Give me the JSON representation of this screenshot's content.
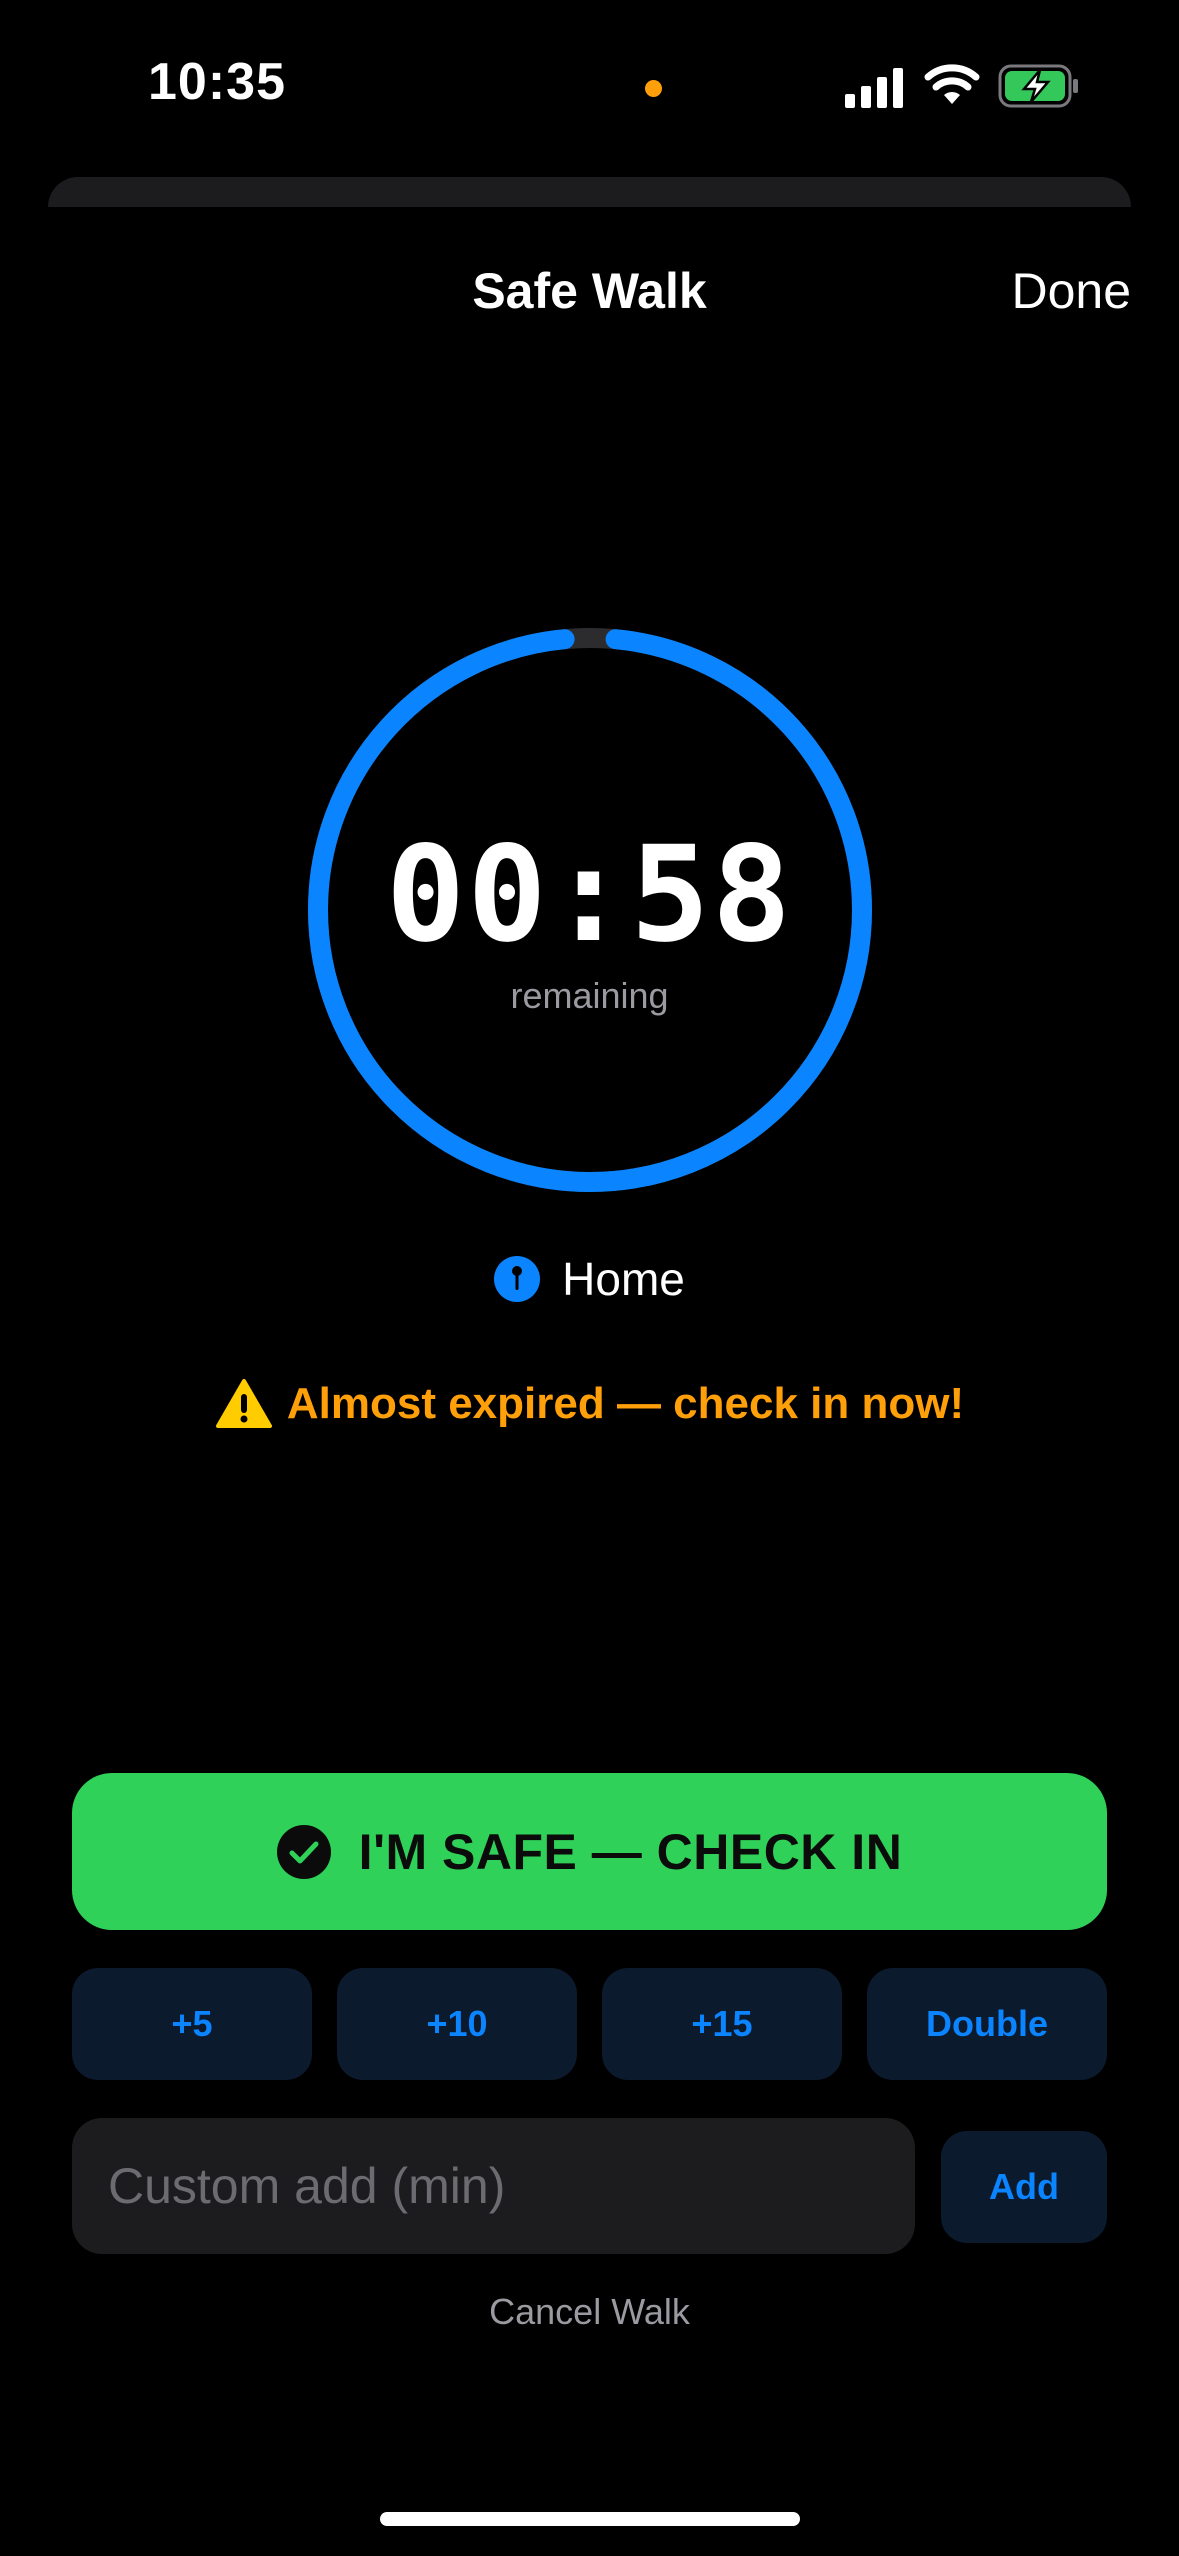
{
  "status_bar": {
    "time": "10:35",
    "privacy_dot_color": "#ff9f0a",
    "icons": [
      "cellular-signal-icon",
      "wifi-icon",
      "battery-charging-icon"
    ],
    "battery_color": "#34c759"
  },
  "nav": {
    "title": "Safe Walk",
    "done_label": "Done"
  },
  "timer": {
    "display": "00:58",
    "caption": "remaining",
    "progress_fraction": 0.97,
    "ring_color": "#0a84ff",
    "track_color": "#2c2c2e"
  },
  "destination": {
    "icon": "map-pin-icon",
    "label": "Home",
    "icon_color": "#0a84ff"
  },
  "warning": {
    "icon": "warning-triangle-icon",
    "text": "Almost expired — check in now!",
    "color": "#ff9f0a"
  },
  "checkin": {
    "label": "I'M SAFE — CHECK IN",
    "icon": "checkmark-circle-icon",
    "color": "#30d158"
  },
  "add_time": {
    "accent": "#0a84ff",
    "buttons": [
      {
        "label": "+5"
      },
      {
        "label": "+10"
      },
      {
        "label": "+15"
      },
      {
        "label": "Double"
      }
    ]
  },
  "custom": {
    "placeholder": "Custom add (min)",
    "value": "",
    "add_label": "Add"
  },
  "cancel_label": "Cancel Walk"
}
